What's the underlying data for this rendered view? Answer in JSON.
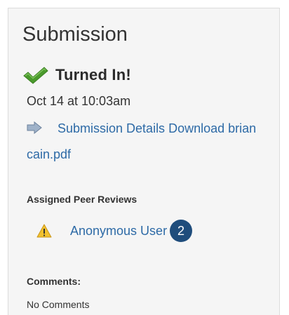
{
  "submission": {
    "title": "Submission",
    "status": "Turned In!",
    "status_icon": "green-check-icon",
    "timestamp": "Oct 14 at 10:03am",
    "details_link": "Submission Details",
    "download_link": "Download brian cain.pdf",
    "details_icon": "arrow-right-icon"
  },
  "peer_reviews": {
    "heading": "Assigned Peer Reviews",
    "items": [
      {
        "user": "Anonymous User",
        "badge_count": "2",
        "icon": "warning-icon"
      }
    ]
  },
  "comments": {
    "heading": "Comments:",
    "text": "No Comments"
  },
  "colors": {
    "link": "#2d6aa6",
    "badge": "#1f4d7c",
    "check": "#4a9a2c",
    "warning": "#f2c12e",
    "panel_bg": "#f5f5f5"
  }
}
